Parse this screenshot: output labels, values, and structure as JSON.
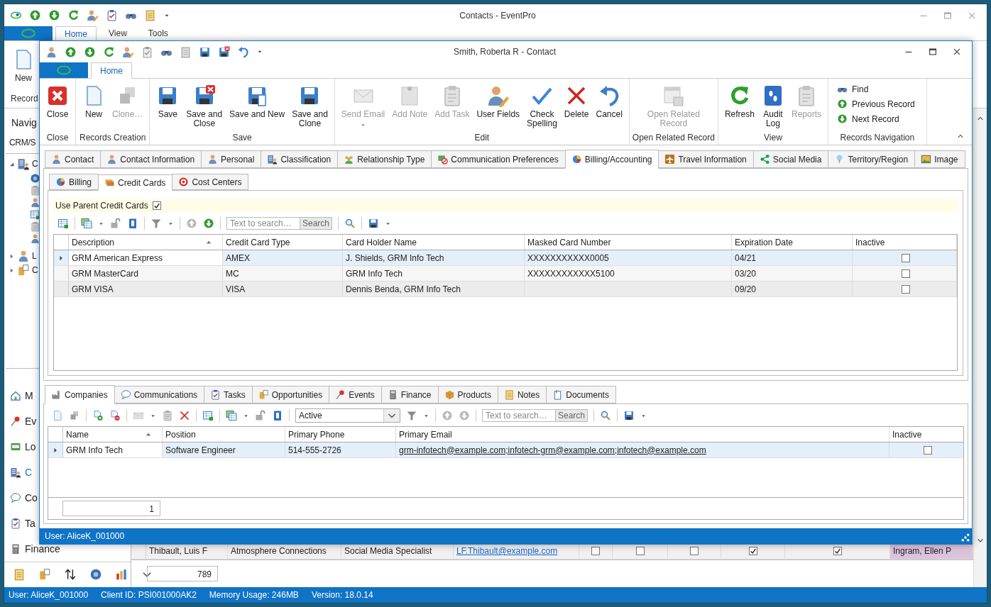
{
  "main_window": {
    "title": "Contacts - EventPro",
    "ribbon_tabs": [
      {
        "label": "Home",
        "selected": true
      },
      {
        "label": "View",
        "selected": false
      },
      {
        "label": "Tools",
        "selected": false
      }
    ],
    "ribbon_button": "New",
    "ribbon_group": "Record",
    "navigation": {
      "header": "Navig",
      "section": "CRM/S",
      "tree": [
        {
          "label": "C",
          "expanded": true
        },
        {
          "label": "L",
          "expanded": false
        },
        {
          "label": "C",
          "expanded": false
        }
      ],
      "items": [
        {
          "label": "M",
          "selected": false
        },
        {
          "label": "Ev",
          "selected": false
        },
        {
          "label": "Lo",
          "selected": false
        },
        {
          "label": "C",
          "selected": true
        },
        {
          "label": "Co",
          "selected": false
        },
        {
          "label": "Ta",
          "selected": false
        },
        {
          "label": "Finance",
          "selected": false
        }
      ]
    },
    "grid": {
      "row": {
        "cells": [
          "Thibault, Luis F",
          "Atmosphere Connections",
          "Social Media Specialist"
        ],
        "email": "LF.Thibault@example.com",
        "flags": [
          {
            "checked": false
          },
          {
            "checked": false
          },
          {
            "checked": false
          },
          {
            "checked": true
          },
          {
            "checked": true
          }
        ],
        "assignee": "Ingram, Ellen P"
      },
      "count": "789"
    },
    "status_bar": [
      "User: AliceK_001000",
      "Client ID: PSI001000AK2",
      "Memory Usage: 246MB",
      "Version: 18.0.14"
    ]
  },
  "dialog": {
    "title": "Smith, Roberta R - Contact",
    "ribbon_tabs": [
      {
        "label": "Home",
        "selected": true
      }
    ],
    "ribbon_groups": [
      {
        "label": "Close",
        "kind": "large",
        "buttons": [
          {
            "label": "Close",
            "disabled": false
          }
        ]
      },
      {
        "label": "Records Creation",
        "kind": "large",
        "buttons": [
          {
            "label": "New",
            "disabled": false
          },
          {
            "label": "Clone…",
            "disabled": true
          }
        ]
      },
      {
        "label": "Save",
        "kind": "large",
        "buttons": [
          {
            "label": "Save",
            "disabled": false
          },
          {
            "label": "Save and\nClose",
            "disabled": false
          },
          {
            "label": "Save and New",
            "disabled": false
          },
          {
            "label": "Save and\nClone",
            "disabled": false
          }
        ]
      },
      {
        "label": "Edit",
        "kind": "large",
        "buttons": [
          {
            "label": "Send Email",
            "disabled": true,
            "dropdown": true
          },
          {
            "label": "Add Note",
            "disabled": true
          },
          {
            "label": "Add Task",
            "disabled": true
          },
          {
            "label": "User Fields",
            "disabled": false
          },
          {
            "label": "Check\nSpelling",
            "disabled": false
          },
          {
            "label": "Delete",
            "disabled": false
          },
          {
            "label": "Cancel",
            "disabled": false
          }
        ]
      },
      {
        "label": "Open Related Record",
        "kind": "large",
        "buttons": [
          {
            "label": "Open Related\nRecord",
            "disabled": true
          }
        ]
      },
      {
        "label": "View",
        "kind": "large",
        "buttons": [
          {
            "label": "Refresh",
            "disabled": false
          },
          {
            "label": "Audit\nLog",
            "disabled": false
          },
          {
            "label": "Reports",
            "disabled": true
          }
        ]
      },
      {
        "label": "Records Navigation",
        "kind": "small",
        "buttons": [
          {
            "label": "Find",
            "disabled": false
          },
          {
            "label": "Previous Record",
            "disabled": false
          },
          {
            "label": "Next Record",
            "disabled": false
          }
        ]
      }
    ],
    "tabs": [
      {
        "label": "Contact",
        "selected": false
      },
      {
        "label": "Contact Information",
        "selected": false
      },
      {
        "label": "Personal",
        "selected": false
      },
      {
        "label": "Classification",
        "selected": false
      },
      {
        "label": "Relationship Type",
        "selected": false
      },
      {
        "label": "Communication Preferences",
        "selected": false
      },
      {
        "label": "Billing/Accounting",
        "selected": true
      },
      {
        "label": "Travel Information",
        "selected": false
      },
      {
        "label": "Social Media",
        "selected": false
      },
      {
        "label": "Territory/Region",
        "selected": false
      },
      {
        "label": "Image",
        "selected": false
      }
    ],
    "sub_tabs": [
      {
        "label": "Billing",
        "selected": false
      },
      {
        "label": "Credit Cards",
        "selected": true
      },
      {
        "label": "Cost Centers",
        "selected": false
      }
    ],
    "use_parent_credit_cards": {
      "label": "Use Parent Credit Cards",
      "checked": true
    },
    "card_search": {
      "placeholder": "Text to search…",
      "button": "Search"
    },
    "cards_table": {
      "columns": [
        {
          "label": "Description",
          "sorted": true
        },
        {
          "label": "Credit Card Type",
          "sorted": false
        },
        {
          "label": "Card Holder Name",
          "sorted": false
        },
        {
          "label": "Masked Card Number",
          "sorted": false
        },
        {
          "label": "Expiration Date",
          "sorted": false
        },
        {
          "label": "Inactive",
          "sorted": false
        }
      ],
      "rows": [
        {
          "selected": true,
          "description": "GRM American Express",
          "type": "AMEX",
          "holder": "J. Shields, GRM Info Tech",
          "masked": "XXXXXXXXXXX0005",
          "expiration": "04/21",
          "inactive": false
        },
        {
          "selected": false,
          "description": "GRM MasterCard",
          "type": "MC",
          "holder": "GRM Info Tech",
          "masked": "XXXXXXXXXXXX5100",
          "expiration": "03/20",
          "inactive": false
        },
        {
          "selected": false,
          "description": "GRM VISA",
          "type": "VISA",
          "holder": "Dennis Benda, GRM Info Tech",
          "expiration": "09/20",
          "inactive": false
        }
      ]
    },
    "related_tabs": [
      {
        "label": "Companies",
        "selected": true
      },
      {
        "label": "Communications",
        "selected": false
      },
      {
        "label": "Tasks",
        "selected": false
      },
      {
        "label": "Opportunities",
        "selected": false
      },
      {
        "label": "Events",
        "selected": false
      },
      {
        "label": "Finance",
        "selected": false
      },
      {
        "label": "Products",
        "selected": false
      },
      {
        "label": "Notes",
        "selected": false
      },
      {
        "label": "Documents",
        "selected": false
      }
    ],
    "related_filter": {
      "value": "Active"
    },
    "related_search": {
      "placeholder": "Text to search…",
      "button": "Search"
    },
    "related_table": {
      "columns": [
        {
          "label": "Name",
          "sorted": true
        },
        {
          "label": "Position",
          "sorted": false
        },
        {
          "label": "Primary Phone",
          "sorted": false
        },
        {
          "label": "Primary Email",
          "sorted": false
        },
        {
          "label": "Inactive",
          "sorted": false
        }
      ],
      "rows": [
        {
          "selected": true,
          "name": "GRM Info Tech",
          "position": "Software Engineer",
          "phone": "514-555-2726",
          "email": "grm-infotech@example.com;infotech-grm@example.com;infotech@example.com",
          "inactive": false
        }
      ],
      "count": "1"
    },
    "status_bar": "User: AliceK_001000"
  }
}
